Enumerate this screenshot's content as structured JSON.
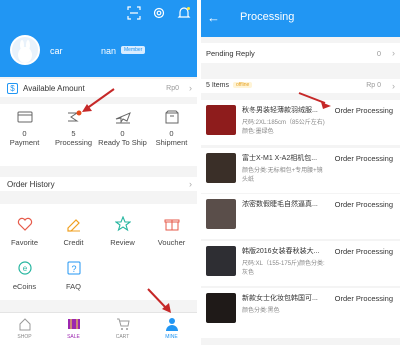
{
  "left": {
    "username_part1": "car",
    "username_part2": "nan",
    "badge": "Member",
    "available_amount": {
      "label": "Available Amount",
      "value": "Rp0"
    },
    "orders": [
      {
        "count": "0",
        "label": "Payment",
        "icon": "wallet-icon"
      },
      {
        "count": "5",
        "label": "Processing",
        "icon": "processing-icon"
      },
      {
        "count": "0",
        "label": "Ready To Ship",
        "icon": "plane-icon"
      },
      {
        "count": "0",
        "label": "Shipment",
        "icon": "box-icon"
      }
    ],
    "order_history": "Order History",
    "grid": [
      {
        "label": "Favorite",
        "icon": "heart-icon"
      },
      {
        "label": "Credit",
        "icon": "credit-icon"
      },
      {
        "label": "Review",
        "icon": "star-icon"
      },
      {
        "label": "Voucher",
        "icon": "voucher-icon"
      },
      {
        "label": "eCoins",
        "icon": "coin-icon"
      },
      {
        "label": "FAQ",
        "icon": "faq-icon"
      }
    ],
    "tabs": [
      {
        "label": "SHOP",
        "icon": "home-icon"
      },
      {
        "label": "SALE",
        "icon": "sale-icon"
      },
      {
        "label": "CART",
        "icon": "cart-icon"
      },
      {
        "label": "MINE",
        "icon": "person-icon"
      }
    ]
  },
  "right": {
    "title": "Processing",
    "pending": {
      "label": "Pending Reply",
      "value": "0"
    },
    "summary": {
      "label": "5 Items",
      "tag": "offline",
      "value": "Rp 0"
    },
    "items": [
      {
        "name": "秋冬男装轻薄款羽绒服...",
        "spec": "尺码:2XL:185cm（85公斤左右)颜色:墨绿色",
        "status": "Order Processing"
      },
      {
        "name": "富士X-M1 X-A2相机包...",
        "spec": "颜色分类:无标相包+专用腰+镜头纸",
        "status": "Order Processing"
      },
      {
        "name": "浓密数假睫毛自然逼真...",
        "spec": "",
        "status": "Order Processing"
      },
      {
        "name": "韩版2016女装春秋装大...",
        "spec": "尺码:XL（155-175斤)颜色分类:灰色",
        "status": "Order Processing"
      },
      {
        "name": "新款女士化妆包韩国可...",
        "spec": "颜色分类:黑色",
        "status": "Order Processing"
      }
    ]
  },
  "colors": {
    "primary": "#2196f3",
    "arrow": "#c62828",
    "notification": "#e64a19"
  }
}
